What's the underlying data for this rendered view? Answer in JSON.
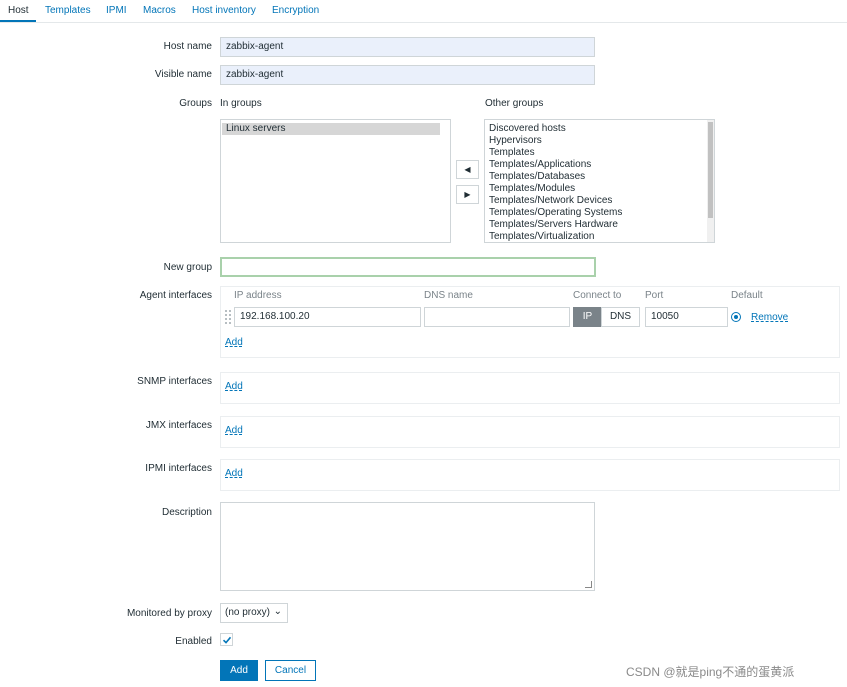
{
  "tabs": [
    "Host",
    "Templates",
    "IPMI",
    "Macros",
    "Host inventory",
    "Encryption"
  ],
  "form": {
    "host_name_label": "Host name",
    "host_name_value": "zabbix-agent",
    "visible_name_label": "Visible name",
    "visible_name_value": "zabbix-agent",
    "groups_label": "Groups",
    "in_groups_label": "In groups",
    "other_groups_label": "Other groups",
    "in_groups": [
      "Linux servers"
    ],
    "other_groups": [
      "Discovered hosts",
      "Hypervisors",
      "Templates",
      "Templates/Applications",
      "Templates/Databases",
      "Templates/Modules",
      "Templates/Network Devices",
      "Templates/Operating Systems",
      "Templates/Servers Hardware",
      "Templates/Virtualization"
    ],
    "move_left_glyph": "◀",
    "move_right_glyph": "▶",
    "new_group_label": "New group",
    "new_group_value": "",
    "agent_interfaces_label": "Agent interfaces",
    "snmp_interfaces_label": "SNMP interfaces",
    "jmx_interfaces_label": "JMX interfaces",
    "ipmi_interfaces_label": "IPMI interfaces",
    "description_label": "Description",
    "description_value": "",
    "proxy_label": "Monitored by proxy",
    "proxy_value": "(no proxy)",
    "enabled_label": "Enabled",
    "enabled": true,
    "add_button": "Add",
    "cancel_button": "Cancel"
  },
  "interface_table": {
    "headers": {
      "ip": "IP address",
      "dns": "DNS name",
      "connect": "Connect to",
      "port": "Port",
      "default": "Default"
    },
    "row": {
      "ip": "192.168.100.20",
      "dns": "",
      "connect_ip": "IP",
      "connect_dns": "DNS",
      "connect_selected": "IP",
      "port": "10050",
      "remove": "Remove"
    },
    "add_link": "Add"
  },
  "add_link": "Add",
  "icons": {
    "chevron": "chevron-down-icon",
    "check": "check-icon",
    "drag": "drag-handle-icon"
  },
  "colors": {
    "accent": "#0275b8",
    "filled_input": "#eaf0fb",
    "focus_border": "#a9d1ab"
  },
  "watermark": "CSDN @就是ping不通的蛋黄派"
}
